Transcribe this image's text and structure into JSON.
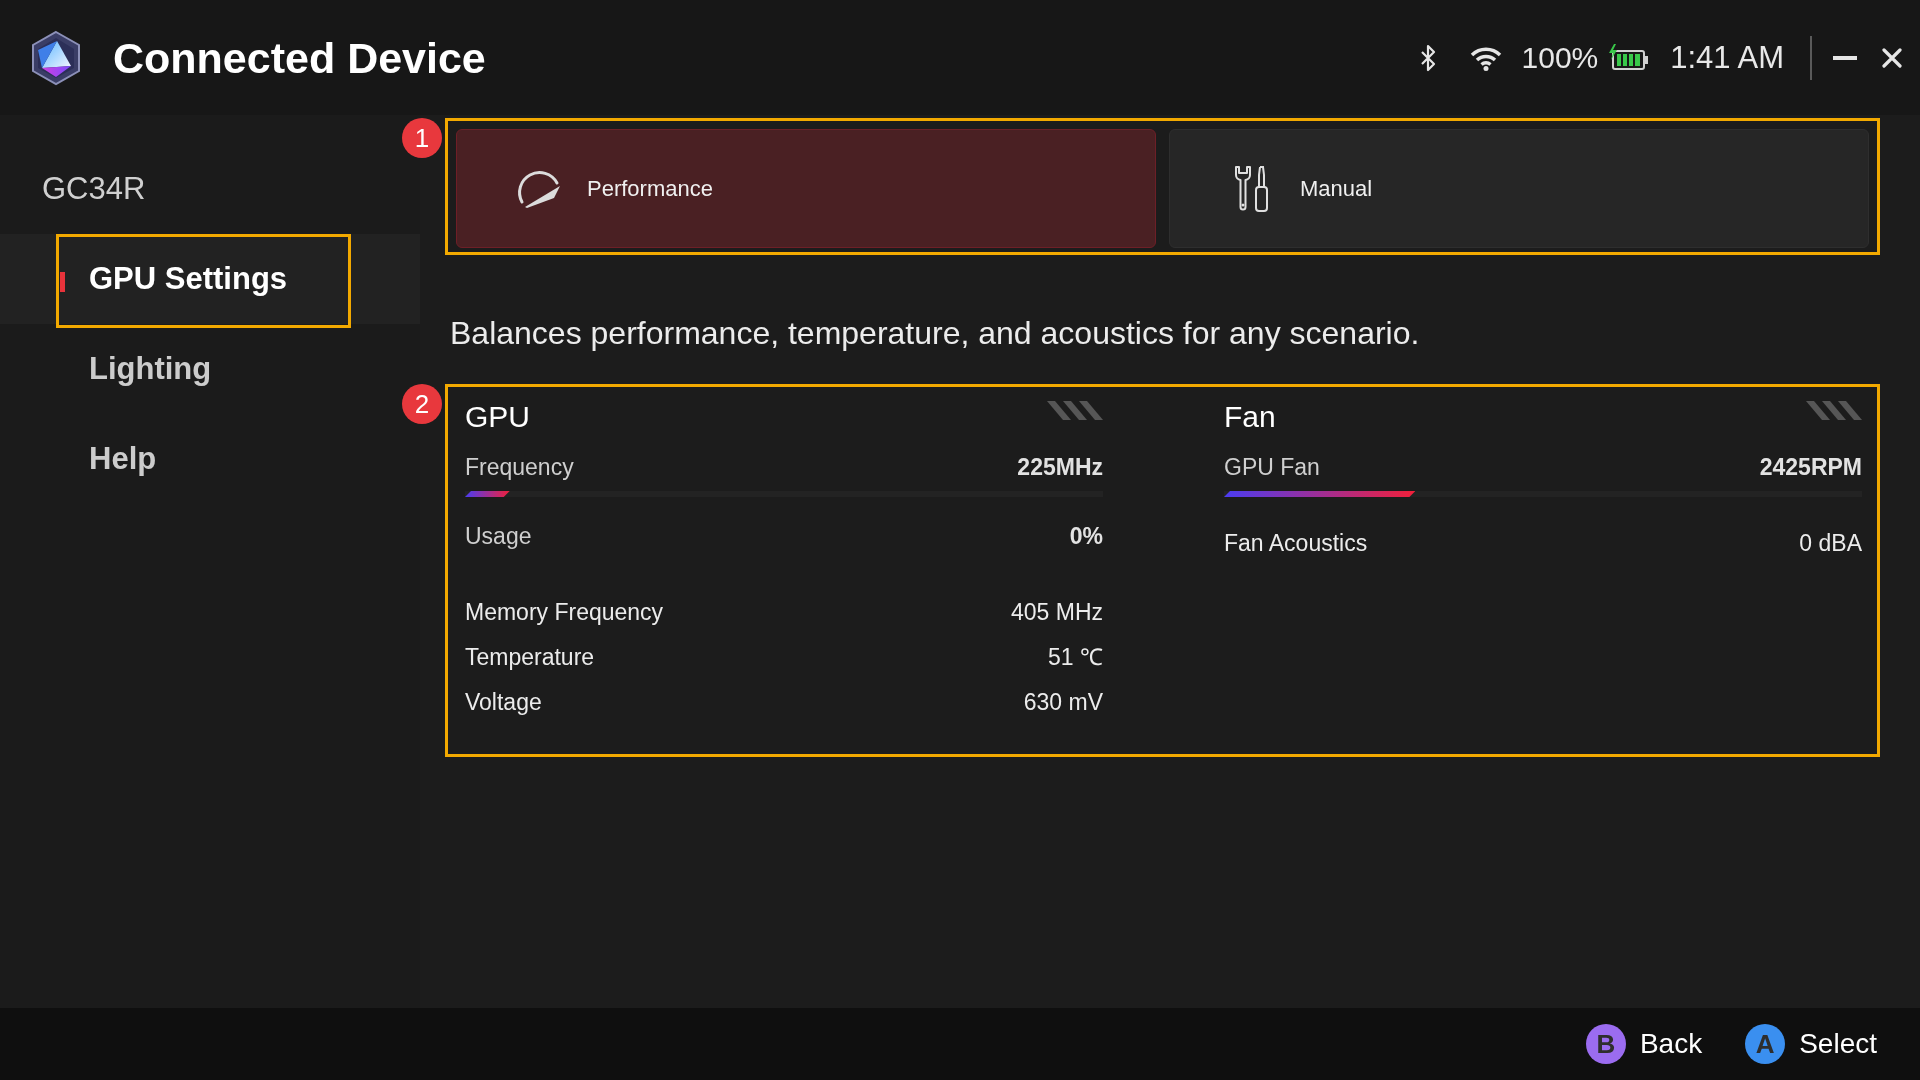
{
  "window": {
    "title": "Connected Device"
  },
  "status_bar": {
    "battery": "100%",
    "time": "1:41 AM"
  },
  "sidebar": {
    "device": "GC34R",
    "items": [
      {
        "label": "GPU Settings",
        "selected": true,
        "highlighted": true
      },
      {
        "label": "Lighting",
        "selected": false,
        "highlighted": false
      },
      {
        "label": "Help",
        "selected": false,
        "highlighted": false
      }
    ]
  },
  "mode_selector": {
    "callout": "1",
    "modes": [
      {
        "kind": "gauge",
        "label": "Performance",
        "selected": true
      },
      {
        "kind": "tools",
        "label": "Manual",
        "selected": false
      }
    ]
  },
  "description": "Balances performance, temperature, and acoustics for any scenario.",
  "monitor": {
    "callout": "2",
    "panels": [
      {
        "title": "GPU",
        "rows": [
          {
            "kind": "meter",
            "label": "Frequency",
            "value": "225MHz",
            "level": 0.07
          },
          {
            "kind": "meter",
            "label": "Usage",
            "value": "0%"
          },
          {
            "kind": "stat",
            "label": "Memory Frequency",
            "value": "405 MHz"
          },
          {
            "kind": "stat",
            "label": "Temperature",
            "value": "51 ℃"
          },
          {
            "kind": "stat",
            "label": "Voltage",
            "value": "630 mV"
          }
        ]
      },
      {
        "title": "Fan",
        "rows": [
          {
            "kind": "meter",
            "label": "GPU Fan",
            "value": "2425RPM",
            "level": 0.3
          },
          {
            "kind": "stat",
            "label": "Fan Acoustics",
            "value": "0 dBA"
          }
        ]
      }
    ]
  },
  "footer": {
    "hints": [
      {
        "key": "B",
        "label": "Back",
        "color": "#9b6cf0"
      },
      {
        "key": "A",
        "label": "Select",
        "color": "#3a8ff0"
      }
    ]
  }
}
